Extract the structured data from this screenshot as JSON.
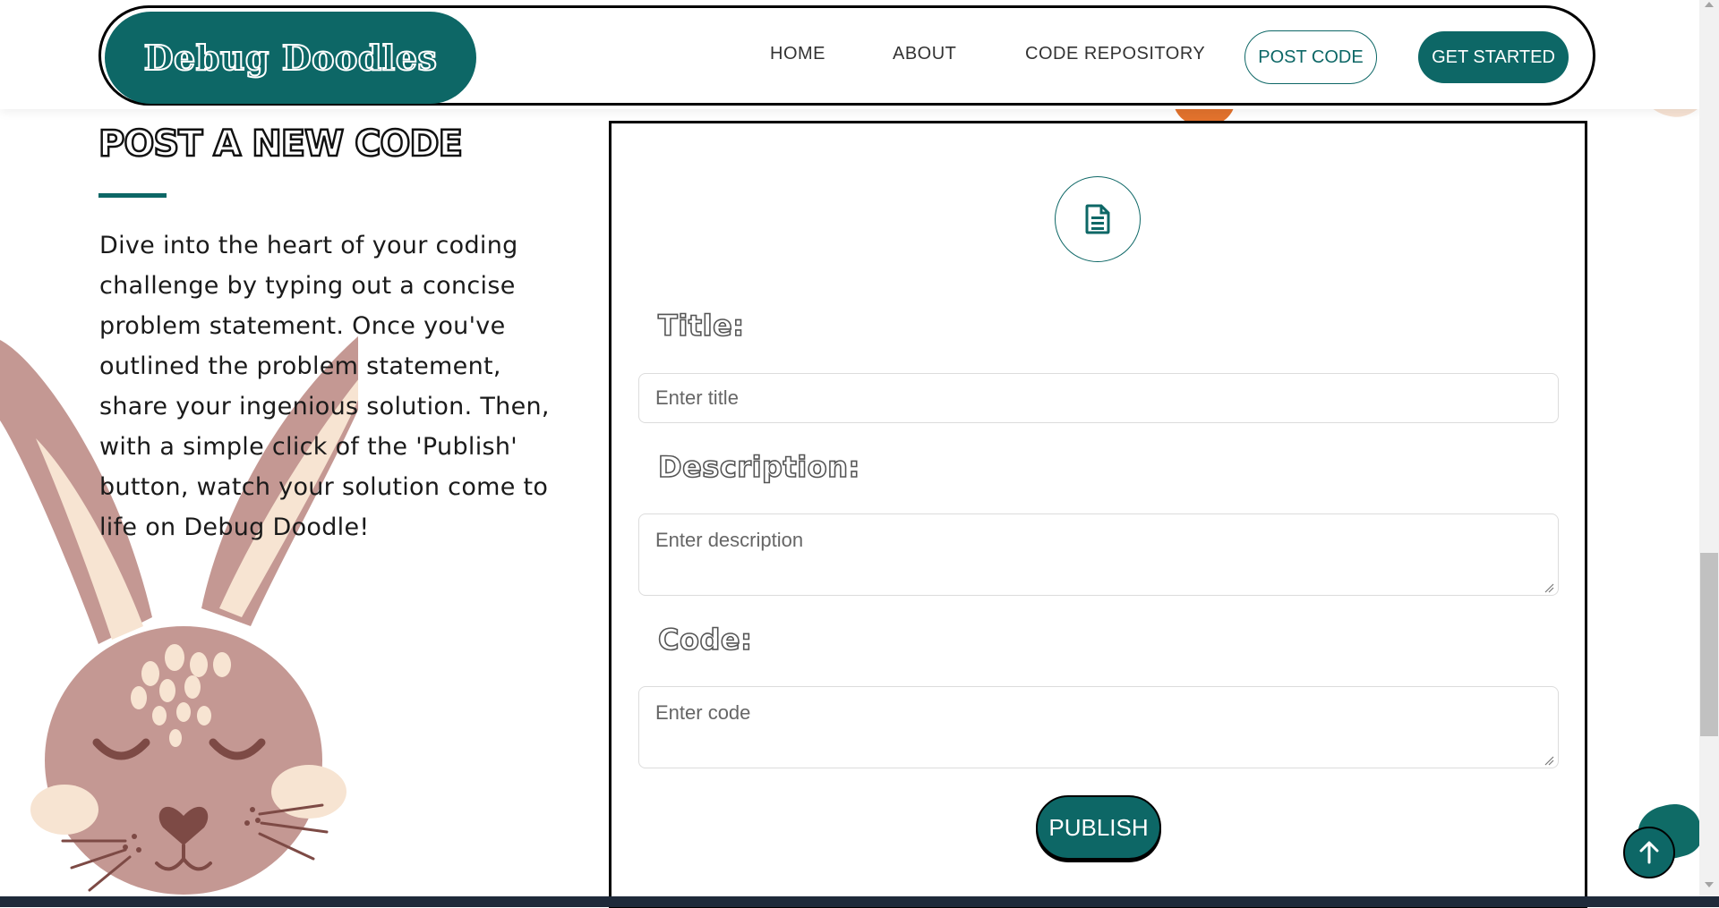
{
  "header": {
    "logo": "Debug Doodles",
    "nav": {
      "home": "HOME",
      "about": "ABOUT",
      "repository": "CODE REPOSITORY",
      "post_code": "POST CODE",
      "get_started": "GET STARTED"
    }
  },
  "intro": {
    "title": "POST A NEW CODE",
    "text": "Dive into the heart of your coding challenge by typing out a concise problem statement. Once you've outlined the problem statement, share your ingenious solution. Then, with a simple click of the 'Publish' button, watch your solution come to life on Debug Doodle!"
  },
  "form": {
    "title_label": "Title:",
    "title_placeholder": "Enter title",
    "description_label": "Description:",
    "description_placeholder": "Enter description",
    "code_label": "Code:",
    "code_placeholder": "Enter code",
    "publish_label": "PUBLISH"
  },
  "icons": {
    "form_icon": "file-text-icon",
    "scroll_top": "arrow-up-icon"
  },
  "colors": {
    "brand_teal": "#0d6766",
    "text_dark": "#1a1a1a",
    "accent_orange": "#f2a313"
  }
}
